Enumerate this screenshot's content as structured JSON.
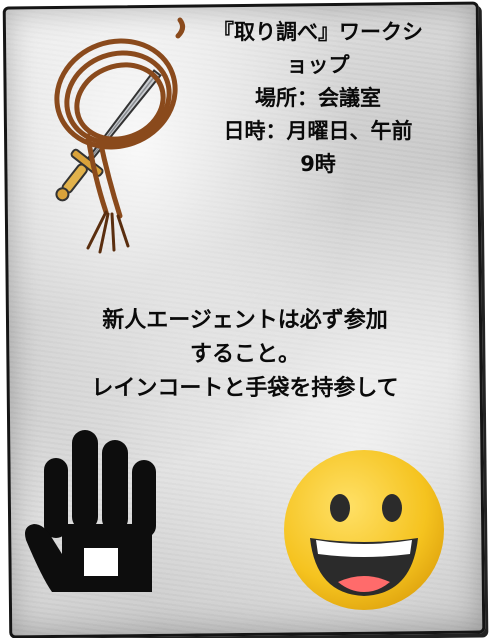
{
  "notice": {
    "header_lines": [
      "『取り調べ』ワークシ",
      "ョップ",
      "場所：会議室",
      "日時：月曜日、午前",
      "9時"
    ],
    "body_lines": [
      "新人エージェントは必ず参加",
      "すること。",
      "レインコートと手袋を持参して"
    ]
  },
  "icons": [
    "whip-and-sword-icon",
    "glove-hand-icon",
    "smiley-face-icon"
  ],
  "colors": {
    "ink": "#0a0a0a",
    "paper": "#d6d6d6",
    "smiley": "#f5c31f",
    "whip": "#8a4a1c"
  }
}
